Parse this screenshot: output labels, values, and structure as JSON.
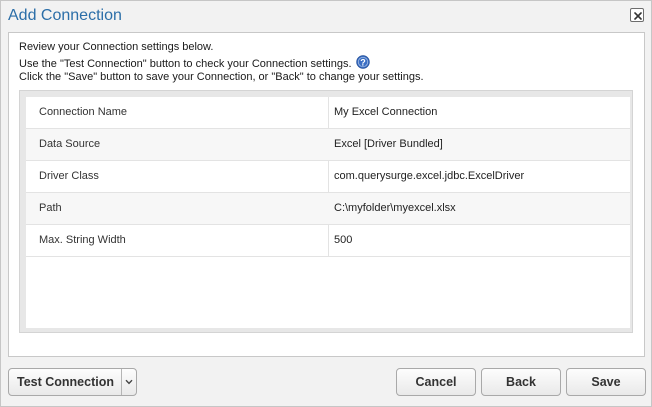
{
  "dialog": {
    "title": "Add Connection",
    "close_icon": "close-icon"
  },
  "intro": {
    "line1": "Review your Connection settings below.",
    "line2": "Use the \"Test Connection\" button to check your Connection settings.",
    "line3": "Click the \"Save\" button to save your Connection, or \"Back\" to change your settings.",
    "help_icon": "help-icon"
  },
  "settings": [
    {
      "label": "Connection Name",
      "value": "My Excel Connection"
    },
    {
      "label": "Data Source",
      "value": "Excel [Driver Bundled]"
    },
    {
      "label": "Driver Class",
      "value": "com.querysurge.excel.jdbc.ExcelDriver"
    },
    {
      "label": "Path",
      "value": "C:\\myfolder\\myexcel.xlsx"
    },
    {
      "label": "Max. String Width",
      "value": "500"
    }
  ],
  "buttons": {
    "test_connection": "Test Connection",
    "cancel": "Cancel",
    "back": "Back",
    "save": "Save"
  },
  "colors": {
    "title": "#2b6ea8",
    "help_icon": "#3b6fc4"
  }
}
